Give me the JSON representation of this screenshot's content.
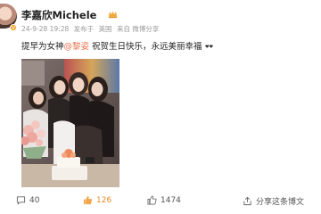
{
  "post": {
    "username": "李嘉欣Michele",
    "timestamp": "24-9-28 19:28",
    "posted_from_prefix": "发布于",
    "location": "英国",
    "source": "来自 微博分享",
    "text_prefix": "提早为女神",
    "mention": "@黎姿",
    "text_suffix": " 祝贺生日快乐，永远美丽幸福",
    "image_alt": "group photo of five women with a birthday cake and flowers"
  },
  "actions": {
    "comments": "40",
    "likes": "126",
    "reposts": "1474",
    "share_label": "分享这条博文"
  },
  "colors": {
    "mention": "#eb7350",
    "like_active": "#e88a2a",
    "crown": "#f2a93b"
  },
  "icons": [
    "avatar",
    "crown-icon",
    "vip-icon",
    "heart-emoji",
    "comment-icon",
    "like-icon",
    "repost-icon",
    "share-icon"
  ]
}
